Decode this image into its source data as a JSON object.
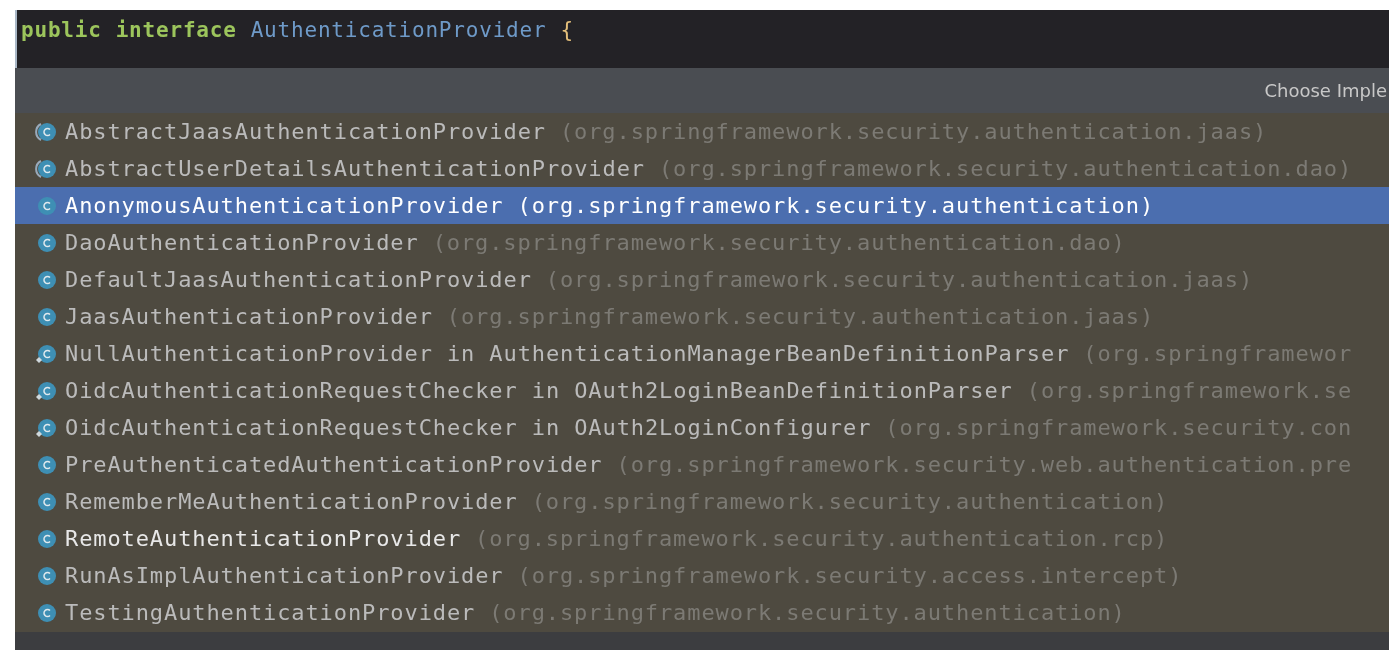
{
  "editor": {
    "code_tokens": [
      {
        "text": "public",
        "kind": "keyword"
      },
      {
        "text": "interface",
        "kind": "keyword"
      },
      {
        "text": "AuthenticationProvider",
        "kind": "type"
      },
      {
        "text": "{",
        "kind": "brace"
      }
    ]
  },
  "popup": {
    "title": "Choose Imple",
    "items": [
      {
        "kind": "abstract",
        "name": "AbstractJaasAuthenticationProvider",
        "package": "(org.springframework.security.authentication.jaas)",
        "selected": false,
        "bright": false
      },
      {
        "kind": "abstract",
        "name": "AbstractUserDetailsAuthenticationProvider",
        "package": "(org.springframework.security.authentication.dao)",
        "selected": false,
        "bright": false
      },
      {
        "kind": "class",
        "name": "AnonymousAuthenticationProvider",
        "package": "(org.springframework.security.authentication)",
        "selected": true,
        "bright": false
      },
      {
        "kind": "class",
        "name": "DaoAuthenticationProvider",
        "package": "(org.springframework.security.authentication.dao)",
        "selected": false,
        "bright": false
      },
      {
        "kind": "class",
        "name": "DefaultJaasAuthenticationProvider",
        "package": "(org.springframework.security.authentication.jaas)",
        "selected": false,
        "bright": false
      },
      {
        "kind": "class",
        "name": "JaasAuthenticationProvider",
        "package": "(org.springframework.security.authentication.jaas)",
        "selected": false,
        "bright": false
      },
      {
        "kind": "inner",
        "name": "NullAuthenticationProvider in AuthenticationManagerBeanDefinitionParser",
        "package": "(org.springframewor",
        "selected": false,
        "bright": false
      },
      {
        "kind": "inner",
        "name": "OidcAuthenticationRequestChecker in OAuth2LoginBeanDefinitionParser",
        "package": "(org.springframework.se",
        "selected": false,
        "bright": false
      },
      {
        "kind": "inner",
        "name": "OidcAuthenticationRequestChecker in OAuth2LoginConfigurer",
        "package": "(org.springframework.security.con",
        "selected": false,
        "bright": false
      },
      {
        "kind": "class",
        "name": "PreAuthenticatedAuthenticationProvider",
        "package": "(org.springframework.security.web.authentication.pre",
        "selected": false,
        "bright": false
      },
      {
        "kind": "class",
        "name": "RememberMeAuthenticationProvider",
        "package": "(org.springframework.security.authentication)",
        "selected": false,
        "bright": false
      },
      {
        "kind": "class",
        "name": "RemoteAuthenticationProvider",
        "package": "(org.springframework.security.authentication.rcp)",
        "selected": false,
        "bright": true
      },
      {
        "kind": "class",
        "name": "RunAsImplAuthenticationProvider",
        "package": "(org.springframework.security.access.intercept)",
        "selected": false,
        "bright": false
      },
      {
        "kind": "class",
        "name": "TestingAuthenticationProvider",
        "package": "(org.springframework.security.authentication)",
        "selected": false,
        "bright": false
      }
    ]
  }
}
